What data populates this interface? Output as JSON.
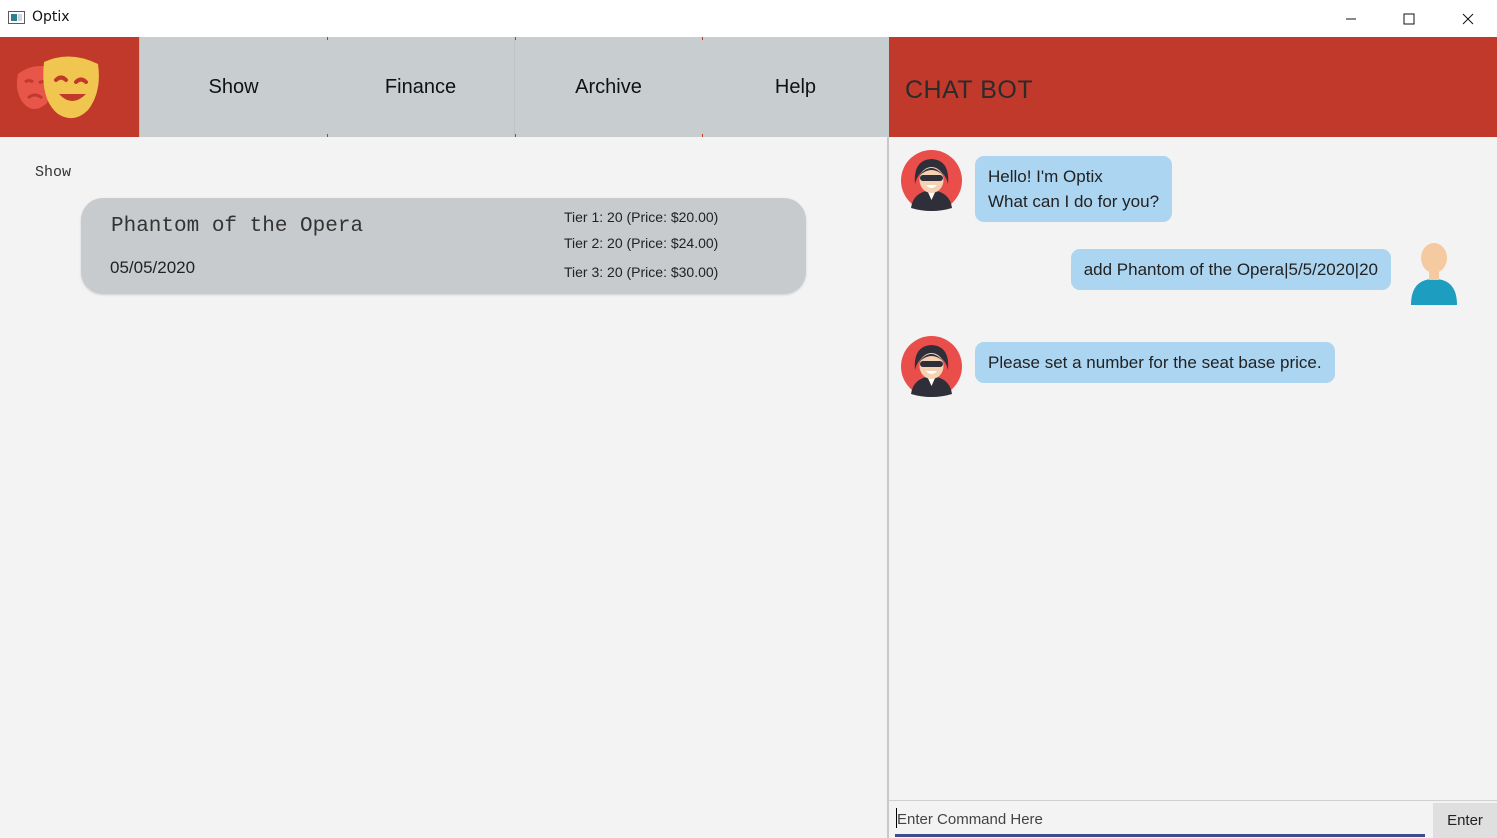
{
  "window": {
    "title": "Optix",
    "controls": [
      "minimize-icon",
      "maximize-icon",
      "close-icon"
    ]
  },
  "header": {
    "logo_icon": "theater-masks-icon",
    "nav": [
      {
        "label": "Show"
      },
      {
        "label": "Finance"
      },
      {
        "label": "Archive"
      },
      {
        "label": "Help"
      }
    ],
    "chat_title": "CHAT BOT"
  },
  "left": {
    "section_label": "Show",
    "shows": [
      {
        "name": "Phantom of the Opera",
        "date": "05/05/2020",
        "tiers": [
          "Tier 1:  20 (Price: $20.00)",
          "Tier 2:  20 (Price: $24.00)",
          "Tier 3:  20 (Price: $30.00)"
        ]
      }
    ]
  },
  "chat": {
    "messages": [
      {
        "from": "bot",
        "lines": [
          "Hello! I'm Optix",
          "What can I do for you?"
        ]
      },
      {
        "from": "user",
        "lines": [
          "add Phantom of the Opera|5/5/2020|20"
        ]
      },
      {
        "from": "bot",
        "lines": [
          "Please set a number for the seat base price."
        ]
      }
    ],
    "input_placeholder": "Enter Command Here",
    "input_value": "",
    "enter_label": "Enter"
  },
  "colors": {
    "header_red": "#c0392b",
    "nav_gray": "#c8cdd0",
    "bubble_blue": "#acd5f1",
    "card_gray": "#c8cbcd"
  }
}
